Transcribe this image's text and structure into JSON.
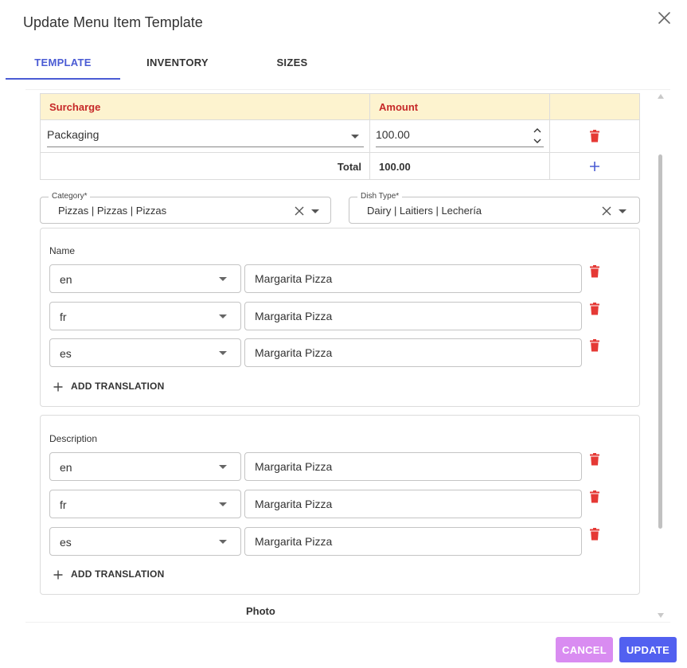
{
  "dialog": {
    "title": "Update Menu Item Template"
  },
  "tabs": [
    {
      "label": "TEMPLATE",
      "active": true
    },
    {
      "label": "INVENTORY",
      "active": false
    },
    {
      "label": "SIZES",
      "active": false
    }
  ],
  "surcharge_table": {
    "headers": {
      "surcharge": "Surcharge",
      "amount": "Amount"
    },
    "rows": [
      {
        "surcharge": "Packaging",
        "amount": "100.00"
      }
    ],
    "total_label": "Total",
    "total_value": "100.00"
  },
  "category": {
    "label": "Category*",
    "value": "Pizzas | Pizzas | Pizzas"
  },
  "dish_type": {
    "label": "Dish Type*",
    "value": "Dairy | Laitiers | Lechería"
  },
  "name_section": {
    "title": "Name",
    "translations": [
      {
        "lang": "en",
        "value": "Margarita Pizza"
      },
      {
        "lang": "fr",
        "value": "Margarita Pizza"
      },
      {
        "lang": "es",
        "value": "Margarita Pizza"
      }
    ],
    "add_label": "ADD TRANSLATION"
  },
  "description_section": {
    "title": "Description",
    "translations": [
      {
        "lang": "en",
        "value": "Margarita Pizza"
      },
      {
        "lang": "fr",
        "value": "Margarita Pizza"
      },
      {
        "lang": "es",
        "value": "Margarita Pizza"
      }
    ],
    "add_label": "ADD TRANSLATION"
  },
  "photo": {
    "label": "Photo"
  },
  "actions": {
    "cancel_label": "CANCEL",
    "update_label": "UPDATE"
  },
  "colors": {
    "accent": "#4a5bd4",
    "delete_icon": "#e53935",
    "table_header_bg": "#fdf3cf",
    "table_header_text": "#c62828",
    "cancel_button": "#d98cf1",
    "update_button": "#5260f0"
  }
}
